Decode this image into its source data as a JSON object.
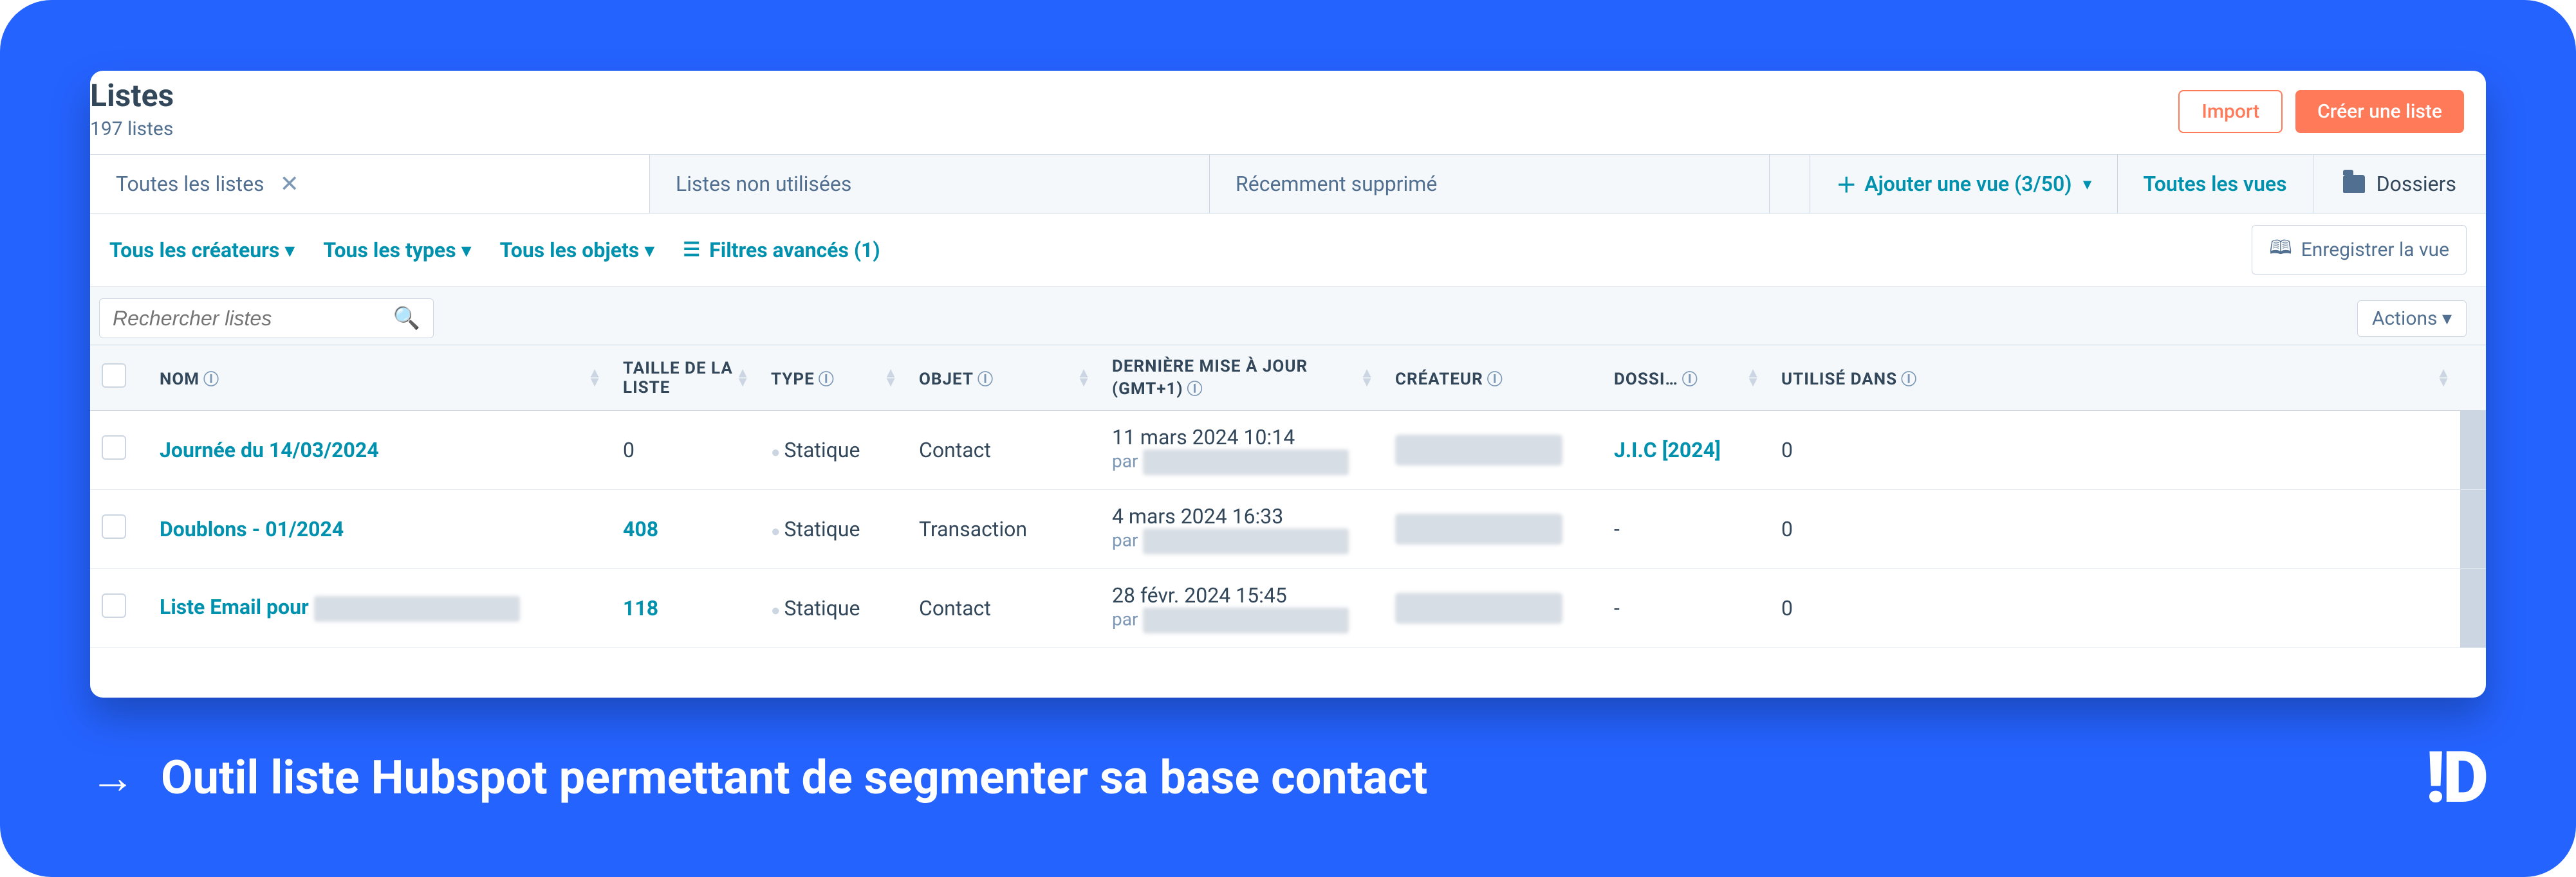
{
  "header": {
    "title": "Listes",
    "subtitle": "197 listes",
    "import_label": "Import",
    "create_label": "Créer une liste"
  },
  "tabs": {
    "all": "Toutes les listes",
    "unused": "Listes non utilisées",
    "deleted": "Récemment supprimé",
    "add_view": "Ajouter une vue (3/50)",
    "all_views": "Toutes les vues",
    "folders": "Dossiers"
  },
  "filters": {
    "creators": "Tous les créateurs",
    "types": "Tous les types",
    "objects": "Tous les objets",
    "advanced": "Filtres avancés (1)",
    "save_view": "Enregistrer la vue"
  },
  "search": {
    "placeholder": "Rechercher listes"
  },
  "actions_label": "Actions ▾",
  "columns": {
    "name": "NOM",
    "size": "TAILLE DE LA LISTE",
    "type": "TYPE",
    "object": "OBJET",
    "updated": "DERNIÈRE MISE À JOUR (GMT+1)",
    "creator": "CRÉATEUR",
    "folder": "DOSSI…",
    "used_in": "UTILISÉ DANS"
  },
  "rows": [
    {
      "name": "Journée du 14/03/2024",
      "size": "0",
      "type": "Statique",
      "object": "Contact",
      "updated": "11 mars 2024 10:14",
      "updated_by_prefix": "par",
      "folder": "J.I.C [2024]",
      "used_in": "0"
    },
    {
      "name": "Doublons - 01/2024",
      "size": "408",
      "type": "Statique",
      "object": "Transaction",
      "updated": "4 mars 2024 16:33",
      "updated_by_prefix": "par",
      "folder": "-",
      "used_in": "0"
    },
    {
      "name": "Liste Email pour",
      "size": "118",
      "type": "Statique",
      "object": "Contact",
      "updated": "28 févr. 2024 15:45",
      "updated_by_prefix": "par",
      "folder": "-",
      "used_in": "0"
    }
  ],
  "caption": "Outil liste Hubspot permettant de segmenter sa base contact",
  "logo": "!D"
}
